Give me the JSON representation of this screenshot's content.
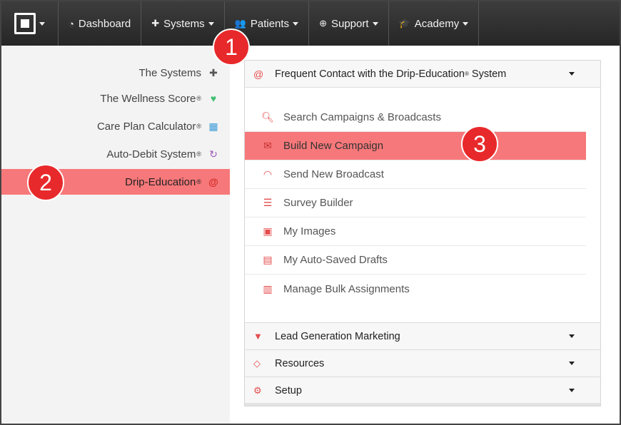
{
  "nav": {
    "items": [
      {
        "label": "Dashboard",
        "icon": "dashboard-icon"
      },
      {
        "label": "Systems",
        "icon": "puzzle-icon"
      },
      {
        "label": "Patients",
        "icon": "users-icon"
      },
      {
        "label": "Support",
        "icon": "lifebuoy-icon"
      },
      {
        "label": "Academy",
        "icon": "graduation-cap-icon"
      }
    ]
  },
  "sidebar": {
    "items": [
      {
        "label": "The Systems",
        "reg": "",
        "icon": "puzzle-icon",
        "color": "#555555"
      },
      {
        "label": "The Wellness Score",
        "reg": "®",
        "icon": "heart-pulse-icon",
        "color": "#3fbf6f"
      },
      {
        "label": "Care Plan Calculator",
        "reg": "®",
        "icon": "calculator-icon",
        "color": "#3a9bd9"
      },
      {
        "label": "Auto-Debit System",
        "reg": "®",
        "icon": "refresh-icon",
        "color": "#9b59b6"
      },
      {
        "label": "Drip-Education",
        "reg": "®",
        "icon": "at-icon",
        "color": "#e54b4b"
      }
    ]
  },
  "panel": {
    "header": {
      "label": "Frequent Contact with the Drip-Education",
      "reg": "®",
      "suffix": " System"
    },
    "menu": [
      {
        "label": "Search Campaigns & Broadcasts",
        "icon": "search-icon"
      },
      {
        "label": "Build New Campaign",
        "icon": "envelope-icon"
      },
      {
        "label": "Send New Broadcast",
        "icon": "rss-icon"
      },
      {
        "label": "Survey Builder",
        "icon": "list-icon"
      },
      {
        "label": "My Images",
        "icon": "image-icon"
      },
      {
        "label": "My Auto-Saved Drafts",
        "icon": "file-icon"
      },
      {
        "label": "Manage Bulk Assignments",
        "icon": "newspaper-icon"
      }
    ],
    "sections": [
      {
        "label": "Lead Generation Marketing",
        "icon": "filter-icon"
      },
      {
        "label": "Resources",
        "icon": "diamond-icon"
      },
      {
        "label": "Setup",
        "icon": "gears-icon"
      }
    ]
  },
  "badges": [
    "1",
    "2",
    "3"
  ],
  "colors": {
    "accent": "#e8292b",
    "highlight": "#f7787a",
    "nav_bg": "#2e2e2e"
  }
}
